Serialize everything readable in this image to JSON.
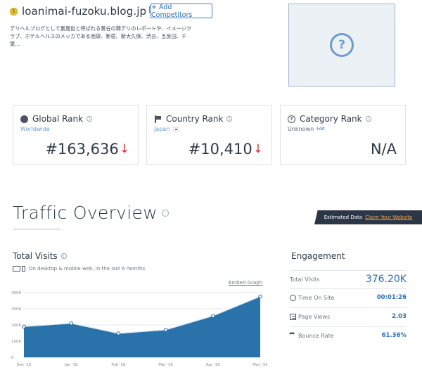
{
  "site": {
    "domain": "loanimai-fuzoku.blog.jp",
    "favicon_icon": "favicon-icon",
    "add_competitors_label": "+ Add Competitors",
    "description": "デリヘルブログとして裏風俗と呼ばれる鶯谷の韓デリのレポートや、イメージクラブ、ホテルヘルスのメッカである池袋、新宿、新大久保、渋谷、五反田、千葉..."
  },
  "thumbnail": {
    "icon": "question-icon",
    "glyph": "?"
  },
  "ranks": {
    "global": {
      "title": "Global Rank",
      "sub": "Worldwide",
      "value": "#163,636",
      "trend": "down"
    },
    "country": {
      "title": "Country Rank",
      "sub": "Japan",
      "value": "#10,410",
      "trend": "down"
    },
    "category": {
      "title": "Category Rank",
      "sub": "Unknown",
      "edit_label": "Edit",
      "value": "N/A"
    }
  },
  "traffic_overview": {
    "title": "Traffic Overview",
    "estimated_label": "Estimated Data",
    "claim_label": "Claim Your Website"
  },
  "total_visits": {
    "title": "Total Visits",
    "subtitle": "On desktop & mobile web, in the last 6 months",
    "embed_label": "Embed Graph"
  },
  "chart_data": {
    "type": "area",
    "categories": [
      "Dec '15",
      "Jan '16",
      "Feb '16",
      "Mar '16",
      "Apr '16",
      "May '16"
    ],
    "values": [
      190000,
      210000,
      148000,
      170000,
      256000,
      376200
    ],
    "yticks": [
      "400K",
      "300K",
      "200K",
      "100K",
      "0"
    ],
    "ylim": [
      0,
      400000
    ],
    "color": "#1f6aa5",
    "grid": true
  },
  "engagement": {
    "title": "Engagement",
    "rows": [
      {
        "label": "Total Visits",
        "value": "376.20K"
      },
      {
        "label": "Time On Site",
        "value": "00:01:26"
      },
      {
        "label": "Page Views",
        "value": "2.03"
      },
      {
        "label": "Bounce Rate",
        "value": "61.36%"
      }
    ]
  },
  "colors": {
    "accent": "#2c6eb5",
    "down_arrow": "#d0312d",
    "banner": "#2b3746",
    "claim": "#f0a14a"
  }
}
